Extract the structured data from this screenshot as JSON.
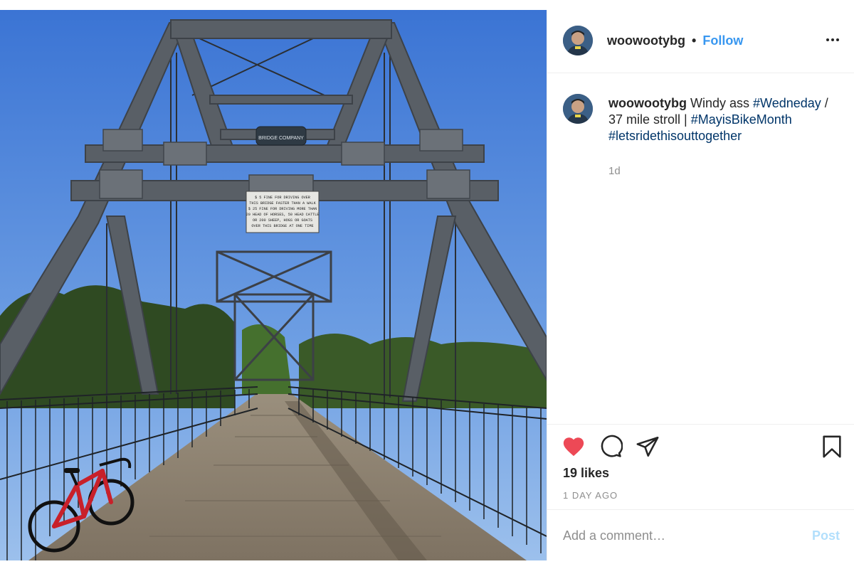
{
  "post": {
    "image_description_icon": "photo-bridge",
    "username": "woowootybg",
    "separator": "•",
    "follow_label": "Follow",
    "more_icon": "more-horizontal-icon"
  },
  "caption": {
    "username": "woowootybg",
    "text_1": " Windy ass ",
    "tag_1": "#Wedneday",
    "text_2": " / 37 mile stroll | ",
    "tag_2": "#MayisBikeMonth",
    "text_3": " ",
    "tag_3": "#letsridethisouttogether",
    "age": "1d"
  },
  "bridge_sign": {
    "top": "BRIDGE COMPANY",
    "line1": "$ 5 FINE FOR DRIVING OVER",
    "line2": "THIS BRIDGE FASTER THAN A WALK",
    "line3": "$ 25 FINE FOR DRIVING MORE THAN",
    "line4": "20 HEAD OF HORSES, 50 HEAD CATTLE",
    "line5": "OR 200 SHEEP, HOGS OR GOATS",
    "line6": "OVER THIS BRIDGE AT ONE TIME"
  },
  "actions": {
    "likes": "19 likes",
    "timestamp": "1 DAY AGO",
    "liked_color": "#ed4956"
  },
  "comment": {
    "placeholder": "Add a comment…",
    "post_label": "Post"
  },
  "colors": {
    "link": "#3897f0",
    "hashtag": "#003569",
    "muted": "#8e8e8e"
  }
}
